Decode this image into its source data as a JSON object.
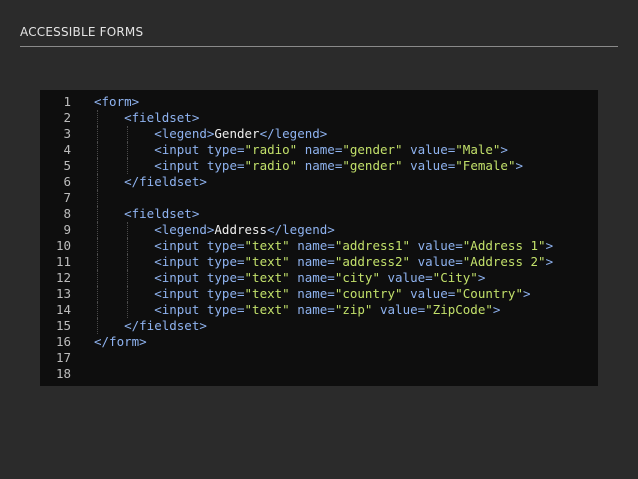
{
  "slide": {
    "title": "ACCESSIBLE FORMS"
  },
  "colors": {
    "background": "#2b2b2b",
    "code_background": "#0e0e0e",
    "tag": "#8fb3f0",
    "string": "#c2e06a",
    "text": "#eeeeee",
    "line_number": "#bcbcbc"
  },
  "code": {
    "language": "html",
    "lines": [
      {
        "number": "1",
        "indent": 0,
        "tokens": [
          {
            "t": "tag",
            "v": "<form>"
          }
        ]
      },
      {
        "number": "2",
        "indent": 1,
        "tokens": [
          {
            "t": "tag",
            "v": "<fieldset>"
          }
        ]
      },
      {
        "number": "3",
        "indent": 2,
        "tokens": [
          {
            "t": "tag",
            "v": "<legend>"
          },
          {
            "t": "text",
            "v": "Gender"
          },
          {
            "t": "tag",
            "v": "</legend>"
          }
        ]
      },
      {
        "number": "4",
        "indent": 2,
        "tokens": [
          {
            "t": "tag",
            "v": "<input "
          },
          {
            "t": "attr",
            "v": "type="
          },
          {
            "t": "str",
            "v": "\"radio\""
          },
          {
            "t": "attr",
            "v": " name="
          },
          {
            "t": "str",
            "v": "\"gender\""
          },
          {
            "t": "attr",
            "v": " value="
          },
          {
            "t": "str",
            "v": "\"Male\""
          },
          {
            "t": "tag",
            "v": ">"
          }
        ]
      },
      {
        "number": "5",
        "indent": 2,
        "tokens": [
          {
            "t": "tag",
            "v": "<input "
          },
          {
            "t": "attr",
            "v": "type="
          },
          {
            "t": "str",
            "v": "\"radio\""
          },
          {
            "t": "attr",
            "v": " name="
          },
          {
            "t": "str",
            "v": "\"gender\""
          },
          {
            "t": "attr",
            "v": " value="
          },
          {
            "t": "str",
            "v": "\"Female\""
          },
          {
            "t": "tag",
            "v": ">"
          }
        ]
      },
      {
        "number": "6",
        "indent": 1,
        "tokens": [
          {
            "t": "tag",
            "v": "</fieldset>"
          }
        ]
      },
      {
        "number": "7",
        "indent": 1,
        "tokens": []
      },
      {
        "number": "8",
        "indent": 1,
        "tokens": [
          {
            "t": "tag",
            "v": "<fieldset>"
          }
        ]
      },
      {
        "number": "9",
        "indent": 2,
        "tokens": [
          {
            "t": "tag",
            "v": "<legend>"
          },
          {
            "t": "text",
            "v": "Address"
          },
          {
            "t": "tag",
            "v": "</legend>"
          }
        ]
      },
      {
        "number": "10",
        "indent": 2,
        "tokens": [
          {
            "t": "tag",
            "v": "<input "
          },
          {
            "t": "attr",
            "v": "type="
          },
          {
            "t": "str",
            "v": "\"text\""
          },
          {
            "t": "attr",
            "v": " name="
          },
          {
            "t": "str",
            "v": "\"address1\""
          },
          {
            "t": "attr",
            "v": " value="
          },
          {
            "t": "str",
            "v": "\"Address 1\""
          },
          {
            "t": "tag",
            "v": ">"
          }
        ]
      },
      {
        "number": "11",
        "indent": 2,
        "tokens": [
          {
            "t": "tag",
            "v": "<input "
          },
          {
            "t": "attr",
            "v": "type="
          },
          {
            "t": "str",
            "v": "\"text\""
          },
          {
            "t": "attr",
            "v": " name="
          },
          {
            "t": "str",
            "v": "\"address2\""
          },
          {
            "t": "attr",
            "v": " value="
          },
          {
            "t": "str",
            "v": "\"Address 2\""
          },
          {
            "t": "tag",
            "v": ">"
          }
        ]
      },
      {
        "number": "12",
        "indent": 2,
        "tokens": [
          {
            "t": "tag",
            "v": "<input "
          },
          {
            "t": "attr",
            "v": "type="
          },
          {
            "t": "str",
            "v": "\"text\""
          },
          {
            "t": "attr",
            "v": " name="
          },
          {
            "t": "str",
            "v": "\"city\""
          },
          {
            "t": "attr",
            "v": " value="
          },
          {
            "t": "str",
            "v": "\"City\""
          },
          {
            "t": "tag",
            "v": ">"
          }
        ]
      },
      {
        "number": "13",
        "indent": 2,
        "tokens": [
          {
            "t": "tag",
            "v": "<input "
          },
          {
            "t": "attr",
            "v": "type="
          },
          {
            "t": "str",
            "v": "\"text\""
          },
          {
            "t": "attr",
            "v": " name="
          },
          {
            "t": "str",
            "v": "\"country\""
          },
          {
            "t": "attr",
            "v": " value="
          },
          {
            "t": "str",
            "v": "\"Country\""
          },
          {
            "t": "tag",
            "v": ">"
          }
        ]
      },
      {
        "number": "14",
        "indent": 2,
        "tokens": [
          {
            "t": "tag",
            "v": "<input "
          },
          {
            "t": "attr",
            "v": "type="
          },
          {
            "t": "str",
            "v": "\"text\""
          },
          {
            "t": "attr",
            "v": " name="
          },
          {
            "t": "str",
            "v": "\"zip\""
          },
          {
            "t": "attr",
            "v": " value="
          },
          {
            "t": "str",
            "v": "\"ZipCode\""
          },
          {
            "t": "tag",
            "v": ">"
          }
        ]
      },
      {
        "number": "15",
        "indent": 1,
        "tokens": [
          {
            "t": "tag",
            "v": "</fieldset>"
          }
        ]
      },
      {
        "number": "16",
        "indent": 0,
        "tokens": [
          {
            "t": "tag",
            "v": "</form>"
          }
        ]
      },
      {
        "number": "17",
        "indent": 0,
        "tokens": []
      },
      {
        "number": "18",
        "indent": 0,
        "tokens": []
      }
    ]
  }
}
